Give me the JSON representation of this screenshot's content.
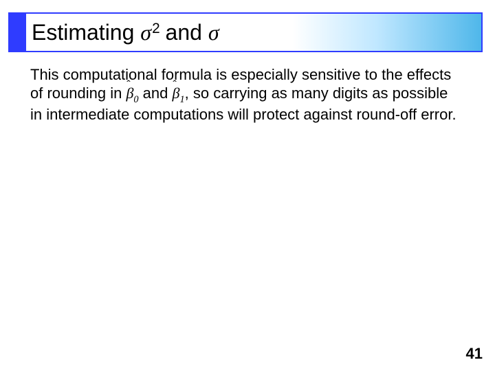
{
  "title": {
    "prefix": "Estimating ",
    "sigma": "σ",
    "squared_exp": "2",
    "mid": " and ",
    "sigma2": "σ"
  },
  "body": {
    "t1": "This computational formula is especially sensitive to the effects of rounding in ",
    "beta0_char": "β",
    "beta0_sub": "0",
    "t2": " and ",
    "beta1_char": "β",
    "beta1_sub": "1",
    "comma": ",",
    "t3": " so carrying as many digits as possible in intermediate computations will protect against round-off error."
  },
  "page_number": "41"
}
